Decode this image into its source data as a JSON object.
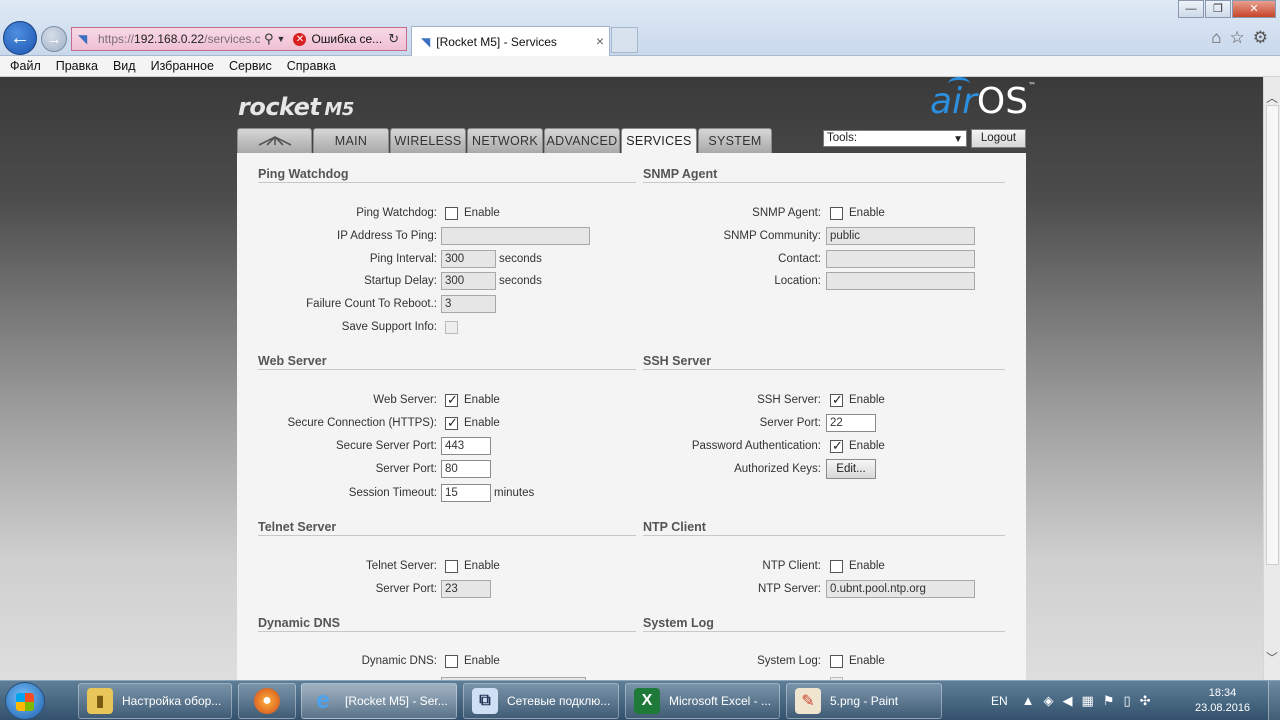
{
  "browser": {
    "url_prefix": "https://",
    "url_host": "192.168.0.22",
    "url_path": "/services.cg",
    "address_error": "Ошибка се...",
    "tab_title": "[Rocket M5] - Services",
    "win_min": "—",
    "win_max": "❐",
    "win_close": "✕"
  },
  "menu": [
    "Файл",
    "Правка",
    "Вид",
    "Избранное",
    "Сервис",
    "Справка"
  ],
  "device": {
    "model_logo": "rocket",
    "model_suffix": "M5",
    "os_logo_air": "air",
    "os_logo_os": "OS",
    "os_logo_tm": "™"
  },
  "nav": {
    "tabs": [
      "MAIN",
      "WIRELESS",
      "NETWORK",
      "ADVANCED",
      "SERVICES",
      "SYSTEM"
    ],
    "active": "SERVICES",
    "tools_label": "Tools:",
    "logout_label": "Logout"
  },
  "sections": {
    "ping_watchdog": {
      "title": "Ping Watchdog",
      "ping_watchdog_label": "Ping Watchdog:",
      "enable": "Enable",
      "ip_label": "IP Address To Ping:",
      "ip_value": "",
      "interval_label": "Ping Interval:",
      "interval_value": "300",
      "interval_unit": "seconds",
      "delay_label": "Startup Delay:",
      "delay_value": "300",
      "delay_unit": "seconds",
      "failure_label": "Failure Count To Reboot.:",
      "failure_value": "3",
      "support_label": "Save Support Info:"
    },
    "snmp": {
      "title": "SNMP Agent",
      "agent_label": "SNMP Agent:",
      "enable": "Enable",
      "community_label": "SNMP Community:",
      "community_value": "public",
      "contact_label": "Contact:",
      "contact_value": "",
      "location_label": "Location:",
      "location_value": ""
    },
    "web_server": {
      "title": "Web Server",
      "server_label": "Web Server:",
      "enable": "Enable",
      "https_label": "Secure Connection (HTTPS):",
      "secure_port_label": "Secure Server Port:",
      "secure_port_value": "443",
      "port_label": "Server Port:",
      "port_value": "80",
      "timeout_label": "Session Timeout:",
      "timeout_value": "15",
      "timeout_unit": "minutes"
    },
    "ssh": {
      "title": "SSH Server",
      "server_label": "SSH Server:",
      "enable": "Enable",
      "port_label": "Server Port:",
      "port_value": "22",
      "password_label": "Password Authentication:",
      "keys_label": "Authorized Keys:",
      "edit_button": "Edit..."
    },
    "telnet": {
      "title": "Telnet Server",
      "server_label": "Telnet Server:",
      "enable": "Enable",
      "port_label": "Server Port:",
      "port_value": "23"
    },
    "ntp": {
      "title": "NTP Client",
      "client_label": "NTP Client:",
      "enable": "Enable",
      "server_label": "NTP Server:",
      "server_value": "0.ubnt.pool.ntp.org"
    },
    "ddns": {
      "title": "Dynamic DNS",
      "ddns_label": "Dynamic DNS:",
      "enable": "Enable"
    },
    "syslog": {
      "title": "System Log",
      "syslog_label": "System Log:",
      "enable": "Enable"
    }
  },
  "checkbox_states": {
    "ping_watchdog": false,
    "snmp_agent": false,
    "save_support_info": false,
    "web_server": true,
    "https": true,
    "ssh_server": true,
    "password_auth": true,
    "telnet_server": false,
    "ntp_client": false,
    "dynamic_dns": false,
    "system_log": false
  },
  "taskbar": {
    "items": [
      {
        "label": "Настройка обор...",
        "icon": "folder-icon"
      },
      {
        "label": "",
        "icon": "firefox-icon"
      },
      {
        "label": "[Rocket M5] - Ser...",
        "icon": "ie-icon"
      },
      {
        "label": "Сетевые подклю...",
        "icon": "network-connections-icon"
      },
      {
        "label": "Microsoft Excel - ...",
        "icon": "excel-icon"
      },
      {
        "label": "5.png - Paint",
        "icon": "paint-icon"
      }
    ],
    "language": "EN",
    "time": "18:34",
    "date": "23.08.2016"
  },
  "colors": {
    "accent": "#2b8fe0",
    "panel_bg": "#f4f4f4",
    "address_warn": "#efc0d2"
  }
}
